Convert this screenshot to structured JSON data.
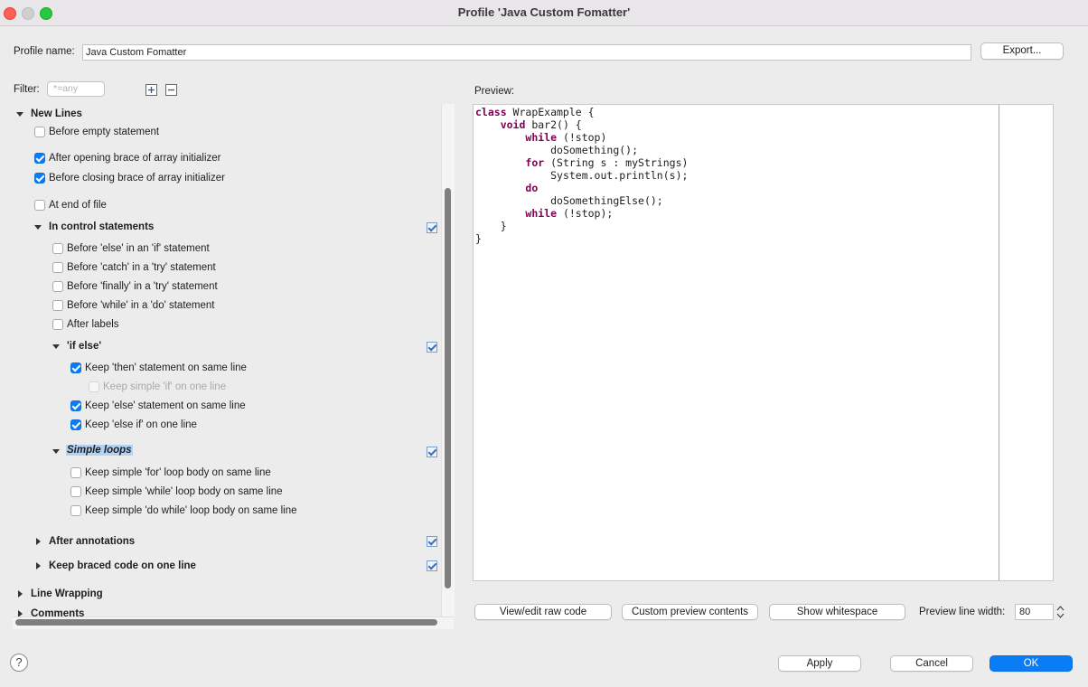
{
  "window": {
    "title": "Profile 'Java Custom Fomatter'"
  },
  "profile": {
    "label": "Profile name:",
    "value": "Java Custom Fomatter",
    "export": "Export..."
  },
  "filter": {
    "label": "Filter:",
    "placeholder": "*=any"
  },
  "tree": {
    "new_lines": "New Lines",
    "before_empty": "Before empty statement",
    "after_open_brace": "After opening brace of array initializer",
    "before_close_brace": "Before closing brace of array initializer",
    "end_of_file": "At end of file",
    "control": "In control statements",
    "before_else": "Before 'else' in an 'if' statement",
    "before_catch": "Before 'catch' in a 'try' statement",
    "before_finally": "Before 'finally' in a 'try' statement",
    "before_while": "Before 'while' in a 'do' statement",
    "after_labels": "After labels",
    "if_else": "'if else'",
    "keep_then": "Keep 'then' statement on same line",
    "keep_simple_if": "Keep simple 'if' on one line",
    "keep_else": "Keep 'else' statement on same line",
    "keep_else_if": "Keep 'else if' on one line",
    "simple_loops": "Simple loops",
    "keep_for": "Keep simple 'for' loop body on same line",
    "keep_while": "Keep simple 'while' loop body on same line",
    "keep_do_while": "Keep simple 'do while' loop body on same line",
    "after_annotations": "After annotations",
    "keep_braced": "Keep braced code on one line",
    "line_wrapping": "Line Wrapping",
    "comments": "Comments"
  },
  "preview": {
    "label": "Preview:",
    "code": [
      {
        "indent": "",
        "kw": "class",
        "rest": " WrapExample {"
      },
      {
        "indent": "    ",
        "kw": "void",
        "rest": " bar2() {"
      },
      {
        "indent": "        ",
        "kw": "while",
        "rest": " (!stop)"
      },
      {
        "indent": "            ",
        "kw": "",
        "rest": "doSomething();"
      },
      {
        "indent": "        ",
        "kw": "for",
        "rest": " (String s : myStrings)"
      },
      {
        "indent": "            ",
        "kw": "",
        "rest": "System.out.println(s);"
      },
      {
        "indent": "        ",
        "kw": "do",
        "rest": ""
      },
      {
        "indent": "            ",
        "kw": "",
        "rest": "doSomethingElse();"
      },
      {
        "indent": "        ",
        "kw": "while",
        "rest": " (!stop);"
      },
      {
        "indent": "    ",
        "kw": "",
        "rest": "}"
      },
      {
        "indent": "",
        "kw": "",
        "rest": "}"
      }
    ],
    "raw_code": "View/edit raw code",
    "custom_preview": "Custom preview contents",
    "show_whitespace": "Show whitespace",
    "line_width_label": "Preview line width:",
    "line_width": "80"
  },
  "footer": {
    "apply": "Apply",
    "cancel": "Cancel",
    "ok": "OK",
    "help": "?"
  },
  "colors": {
    "accent": "#0a7cf5",
    "keyword": "#7f0055",
    "selection": "#b3d1f5"
  }
}
